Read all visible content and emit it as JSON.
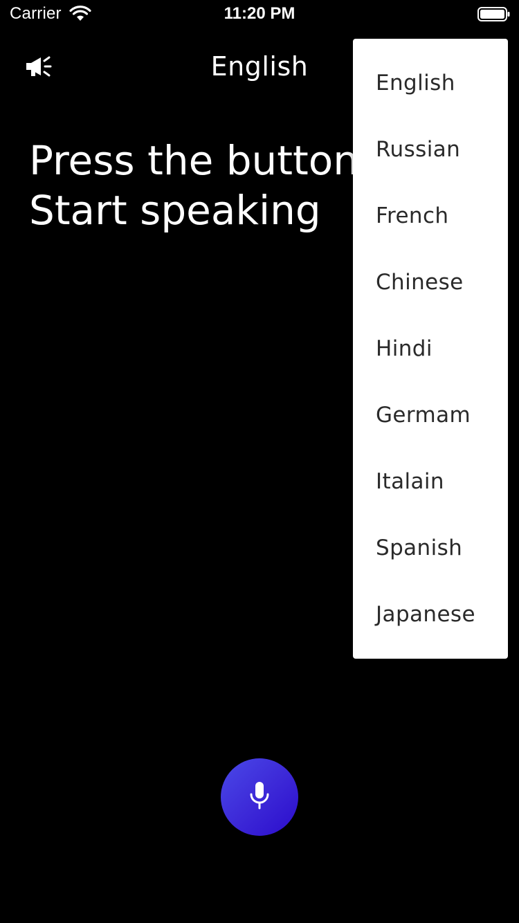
{
  "status_bar": {
    "carrier": "Carrier",
    "time": "11:20 PM",
    "wifi_icon": "wifi-icon",
    "battery_icon": "battery-full-icon"
  },
  "app_bar": {
    "speaker_icon": "megaphone-icon",
    "title": "English"
  },
  "prompt": {
    "line1": "Press the button",
    "line2": "Start speaking"
  },
  "language_menu": {
    "items": [
      {
        "label": "English"
      },
      {
        "label": "Russian"
      },
      {
        "label": "French"
      },
      {
        "label": "Chinese"
      },
      {
        "label": "Hindi"
      },
      {
        "label": "Germam"
      },
      {
        "label": "Italain"
      },
      {
        "label": "Spanish"
      },
      {
        "label": "Japanese"
      }
    ]
  },
  "mic_button": {
    "icon": "microphone-icon",
    "colors": [
      "#4a49e8",
      "#2b0ccc"
    ]
  },
  "colors": {
    "background": "#000000",
    "text": "#ffffff",
    "menu_background": "#ffffff",
    "menu_text": "#2a2a2a"
  }
}
